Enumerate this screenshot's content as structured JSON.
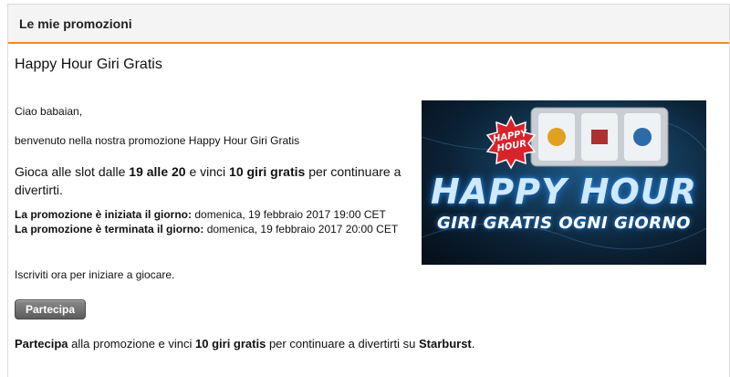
{
  "header": {
    "title": "Le mie promozioni"
  },
  "promo": {
    "title": "Happy Hour Giri Gratis",
    "greeting": "Ciao babaian,",
    "welcome": "benvenuto nella nostra promozione Happy Hour Giri Gratis",
    "lead": {
      "part1": "Gioca alle slot dalle ",
      "hours": "19 alle 20",
      "part2": " e vinci ",
      "spins": "10 giri gratis",
      "part3": " per continuare a divertirti."
    },
    "start": {
      "label": "La promozione è iniziata il giorno:",
      "value": " domenica, 19 febbraio 2017 19:00 CET"
    },
    "end": {
      "label": "La promozione è terminata il giorno:",
      "value": " domenica, 19 febbraio 2017 20:00 CET"
    },
    "signup": "Iscriviti ora per iniziare a giocare.",
    "button_label": "Partecipa",
    "footer": {
      "part1": "Partecipa",
      "part2": " alla promozione e vinci ",
      "spins": "10 giri gratis",
      "part3": " per continuare a divertirti su ",
      "game": "Starburst",
      "part4": "."
    }
  },
  "banner": {
    "badge_line1": "HAPPY",
    "badge_line2": "HOUR",
    "headline": "HAPPY HOUR",
    "subline": "GIRI GRATIS OGNI GIORNO"
  },
  "colors": {
    "accent": "#f08a24",
    "button": "#6b6b6b",
    "badge": "#d8232a"
  }
}
